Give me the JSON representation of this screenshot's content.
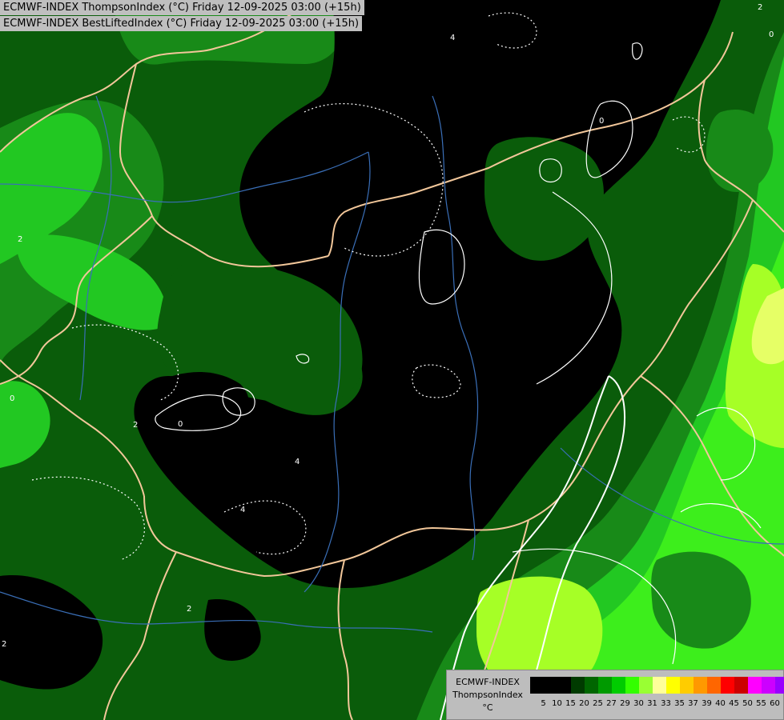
{
  "titles": {
    "line1": "ECMWF-INDEX ThompsonIndex (°C) Friday 12-09-2025 03:00 (+15h)",
    "line2": "ECMWF-INDEX BestLiftedIndex (°C) Friday 12-09-2025 03:00 (+15h)"
  },
  "legend": {
    "source": "ECMWF-INDEX",
    "parameter": "ThompsonIndex",
    "unit": "°C",
    "ticks": [
      "5",
      "10",
      "15",
      "20",
      "25",
      "27",
      "29",
      "30",
      "31",
      "33",
      "35",
      "37",
      "39",
      "40",
      "45",
      "50",
      "55",
      "60"
    ],
    "colors": [
      "#000000",
      "#000000",
      "#000000",
      "#003b00",
      "#006600",
      "#009a00",
      "#00cc00",
      "#33ff00",
      "#99ff33",
      "#ffff99",
      "#ffff00",
      "#ffcc00",
      "#ff9900",
      "#ff6600",
      "#ff0000",
      "#cc0000",
      "#ff00ff",
      "#cc00ff",
      "#9900ff",
      "#6600ff",
      "#0000ff"
    ]
  },
  "map": {
    "contour_labels": [
      "4",
      "0",
      "2",
      "2",
      "0",
      "0",
      "2",
      "4",
      "4",
      "2",
      "2",
      "0"
    ],
    "colors": {
      "black_zone": "#000000",
      "dark_green": "#0a5c0a",
      "mid_green": "#188a18",
      "bright_green": "#22c822",
      "lime": "#3dee1c",
      "yellow_green": "#a6ff26",
      "pale_yellow": "#e6ff66",
      "border": "#f2c79a",
      "river": "#3a6fb8",
      "contour": "#ffffff"
    }
  }
}
